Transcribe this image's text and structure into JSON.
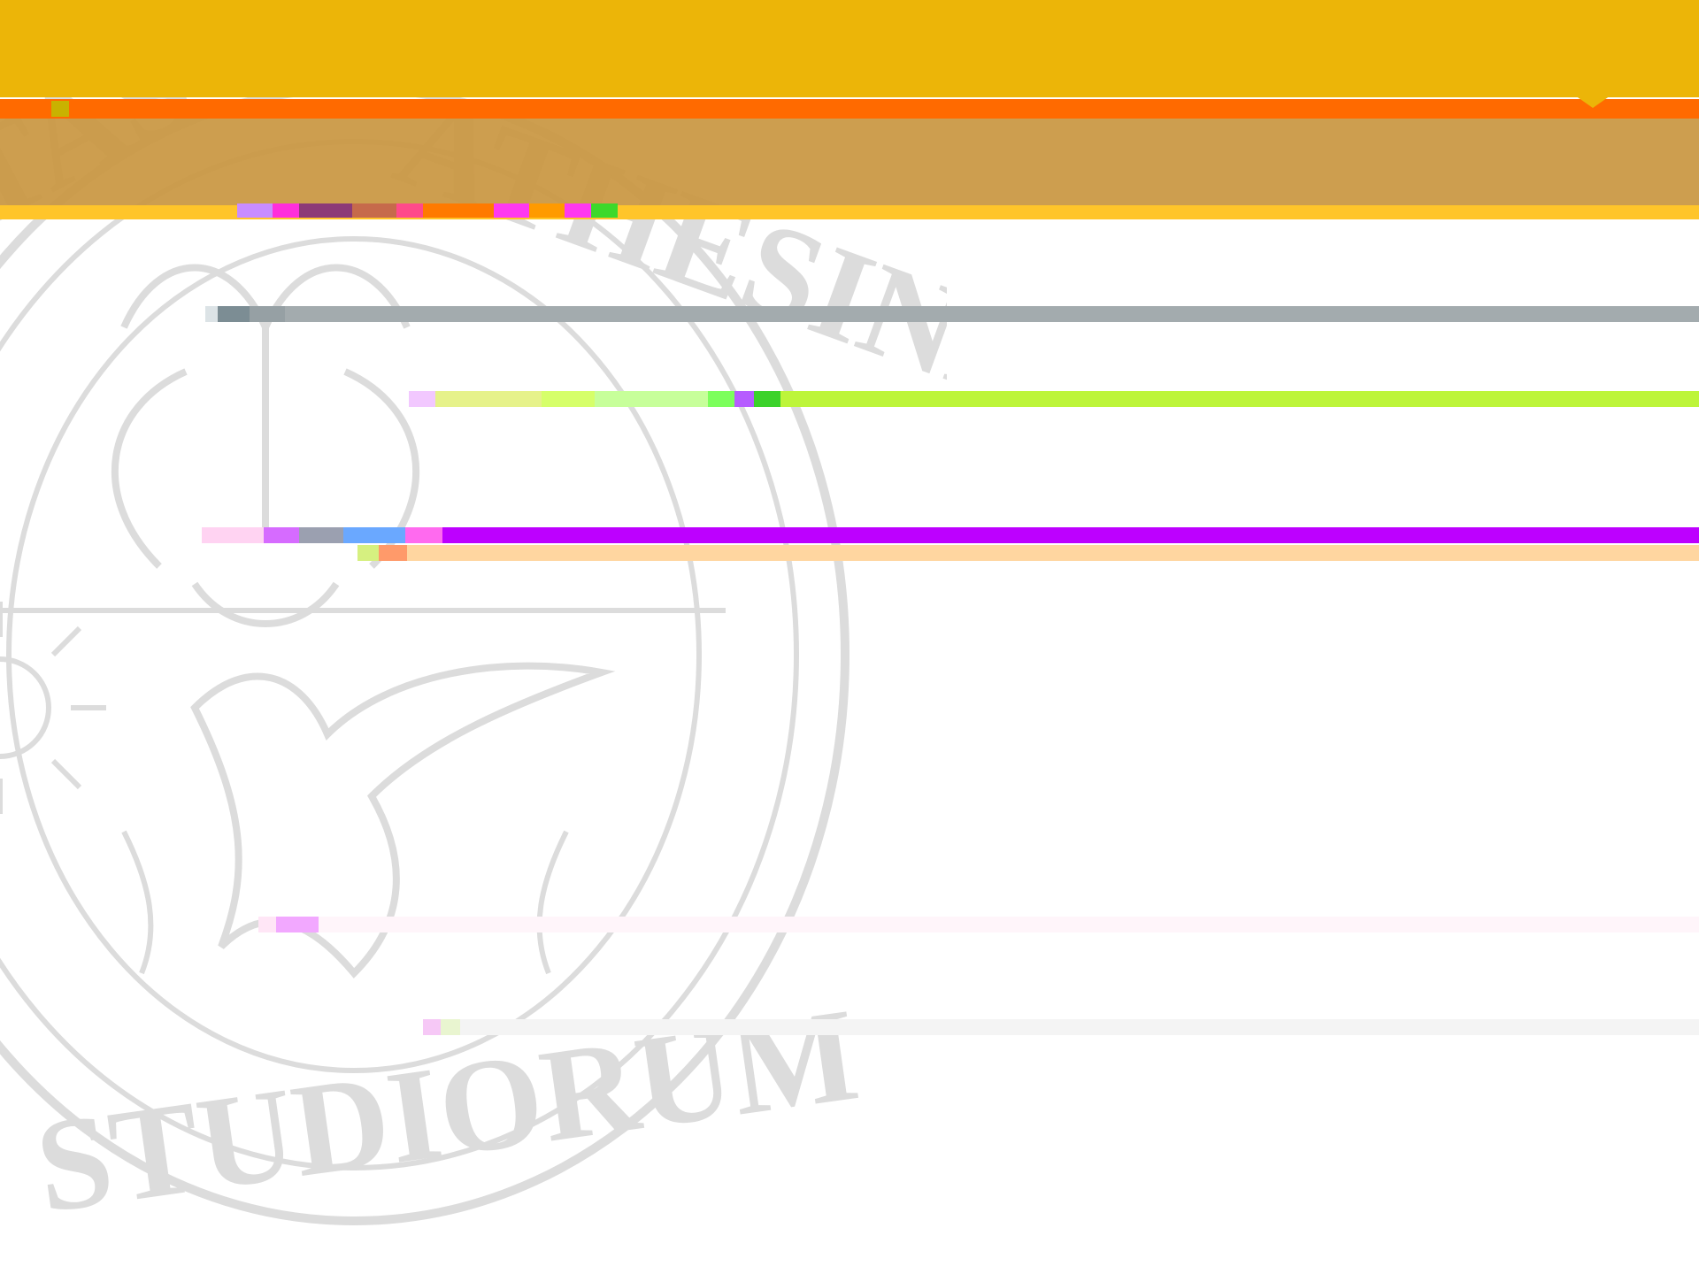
{
  "colors": {
    "header_top": "#ECB508",
    "header_stripe_orange": "#FF6A00",
    "header_lower": "#C99640",
    "accent_yellow_line": "#FFC52A",
    "gray_bar": "#A3ABAE",
    "lime_bar": "#BDF53A",
    "purple_bar": "#BD00FF",
    "peach_bar": "#FFD6A0",
    "pale_bar_pink": "#FFF5FA",
    "pale_bar_gray": "#F4F4F4",
    "seal_stroke": "#DCDCDC",
    "background": "#FFFFFF"
  },
  "watermark": {
    "icon": "university-seal-icon",
    "motto": "VERITAS ✶ ATHESINA STUDIORUM"
  },
  "decoration": {
    "header_marker_icon": "chevron-down-icon"
  }
}
